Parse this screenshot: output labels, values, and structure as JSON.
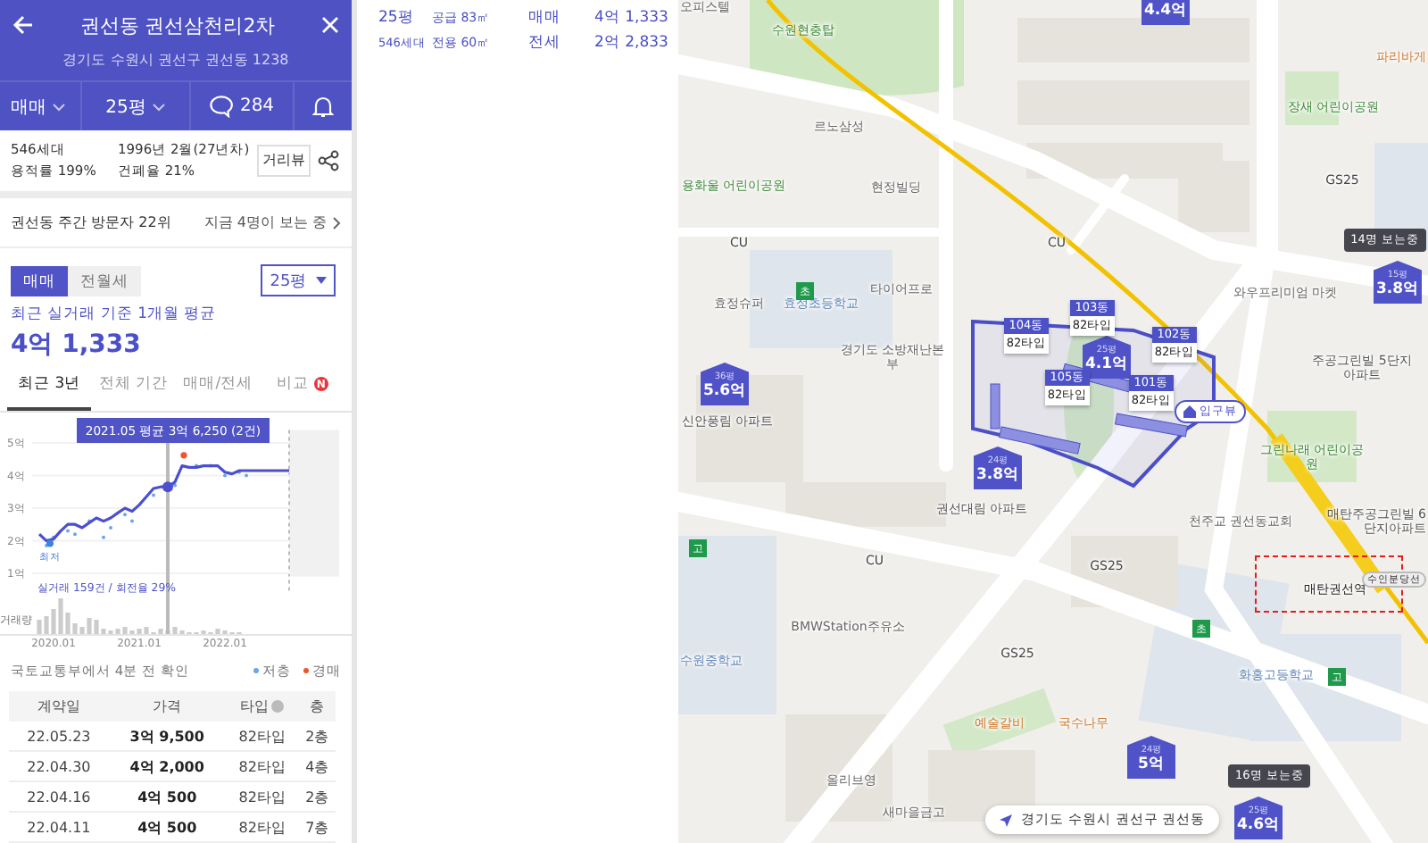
{
  "header": {
    "title": "권선동 권선삼천리2차",
    "address": "경기도 수원시 권선구 권선동 1238",
    "deal_type": "매매",
    "size": "25평",
    "comments": "284"
  },
  "info": {
    "households": "546세대",
    "floor_area_ratio": "용적률 199%",
    "built": "1996년 2월(27년차)",
    "coverage_ratio": "건폐율 21%",
    "street_view": "거리뷰"
  },
  "visitors": {
    "rank": "권선동 주간 방문자 22위",
    "viewing": "지금 4명이 보는 중"
  },
  "deal_toggle": [
    {
      "label": "매매",
      "selected": true
    },
    {
      "label": "전월세",
      "selected": false
    }
  ],
  "size_select": "25평",
  "average": {
    "caption": "최근 실거래 기준 1개월 평균",
    "price": "4억 1,333"
  },
  "period_tabs": [
    {
      "label": "최근 3년",
      "selected": true
    },
    {
      "label": "전체 기간",
      "selected": false
    },
    {
      "label": "매매/전세",
      "selected": false
    },
    {
      "label": "비교",
      "selected": false,
      "badge": "N"
    }
  ],
  "chart": {
    "tooltip": "2021.05 평균 3억 6,250 (2건)",
    "min_label": "최저",
    "stats": "실거래 159건 / 회전율 29%",
    "volume_label": "거래량",
    "chart_data": {
      "type": "line",
      "categories": [
        null,
        null,
        "2020.01",
        null,
        null,
        null,
        null,
        null,
        null,
        null,
        null,
        null,
        null,
        null,
        "2021.01",
        null,
        null,
        null,
        null,
        null,
        null,
        null,
        null,
        null,
        null,
        null,
        "2022.01",
        null,
        null,
        null,
        null,
        null,
        null,
        null,
        null,
        null
      ],
      "ylim": [
        0.9,
        5.4
      ],
      "grid": true,
      "series": [
        {
          "color": "#4b4fd0",
          "values": [
            2.2,
            2.0,
            2.05,
            2.3,
            2.5,
            2.5,
            2.4,
            2.55,
            2.7,
            2.6,
            2.7,
            2.85,
            3.0,
            2.9,
            3.1,
            3.35,
            3.6,
            3.65,
            3.65,
            3.8,
            4.3,
            4.25,
            4.25,
            4.3,
            4.3,
            4.3,
            4.1,
            4.05,
            4.15,
            4.15,
            4.15,
            4.15,
            4.15,
            4.15,
            4.15,
            4.15
          ]
        }
      ],
      "yticks": [
        {
          "value": 1,
          "label": "1억"
        },
        {
          "value": 2,
          "label": "2억"
        },
        {
          "value": 3,
          "label": "3억"
        },
        {
          "value": 4,
          "label": "4억"
        },
        {
          "value": 5,
          "label": "5억"
        }
      ]
    }
  },
  "source": "국토교통부에서 4분 전 확인",
  "legend": [
    {
      "label": "저층",
      "color": "#6aa6ea"
    },
    {
      "label": "경매",
      "color": "#f0532e"
    }
  ],
  "table": {
    "columns": [
      "계약일",
      "가격",
      "타입",
      "층"
    ],
    "rows": [
      [
        "22.05.23",
        "3억 9,500",
        "82타입",
        "2층"
      ],
      [
        "22.04.30",
        "4억 2,000",
        "82타입",
        "4층"
      ],
      [
        "22.04.16",
        "4억 500",
        "82타입",
        "2층"
      ],
      [
        "22.04.11",
        "4억 500",
        "82타입",
        "7층"
      ]
    ]
  },
  "summary": [
    {
      "size": "25평",
      "area": "공급 83㎡",
      "deal": "매매",
      "price": "4억 1,333"
    },
    {
      "size": "546세대",
      "area": "전용 60㎡",
      "deal": "전세",
      "price": "2억 2,833"
    }
  ],
  "map": {
    "places": [
      {
        "name": "오피스텔",
        "kind": "building"
      },
      {
        "name": "수원현충탑",
        "kind": "park"
      },
      {
        "name": "르노삼성",
        "kind": "building"
      },
      {
        "name": "용화울 어린이공원",
        "kind": "park"
      },
      {
        "name": "현정빌딩",
        "kind": "building"
      },
      {
        "name": "CU",
        "kind": "shop"
      },
      {
        "name": "CU",
        "kind": "shop"
      },
      {
        "name": "효정슈퍼",
        "kind": "building"
      },
      {
        "name": "효정초등학교",
        "kind": "school"
      },
      {
        "name": "타이어프로",
        "kind": "building"
      },
      {
        "name": "경기도 소방재난본부",
        "kind": "building"
      },
      {
        "name": "장새 어린이공원",
        "kind": "park"
      },
      {
        "name": "GS25",
        "kind": "shop"
      },
      {
        "name": "와우프리미엄 마켓",
        "kind": "building"
      },
      {
        "name": "주공그린빌 5단지아파트",
        "kind": "apartment"
      },
      {
        "name": "신안풍림 아파트",
        "kind": "apartment"
      },
      {
        "name": "권선대림 아파트",
        "kind": "apartment"
      },
      {
        "name": "CU",
        "kind": "shop"
      },
      {
        "name": "GS25",
        "kind": "shop"
      },
      {
        "name": "GS25",
        "kind": "shop"
      },
      {
        "name": "BMWStation주유소",
        "kind": "building"
      },
      {
        "name": "수원중학교",
        "kind": "school"
      },
      {
        "name": "예술갈비",
        "kind": "food"
      },
      {
        "name": "국수나무",
        "kind": "food"
      },
      {
        "name": "올리브영",
        "kind": "building"
      },
      {
        "name": "새마을금고",
        "kind": "building"
      },
      {
        "name": "천주교 권선동교회",
        "kind": "building"
      },
      {
        "name": "그린나래 어린이공원",
        "kind": "park"
      },
      {
        "name": "매탄주공그린빌 6단지아파트",
        "kind": "apartment"
      },
      {
        "name": "매탄권선역",
        "kind": "station"
      },
      {
        "name": "화홍고등학교",
        "kind": "school"
      },
      {
        "name": "파리바게",
        "kind": "food"
      }
    ],
    "school_flags": [
      {
        "label": "초"
      },
      {
        "label": "고"
      },
      {
        "label": "초"
      },
      {
        "label": "고"
      }
    ],
    "price_markers": [
      {
        "price": "4.4억"
      },
      {
        "size": "15평",
        "price": "3.8억"
      },
      {
        "size": "36평",
        "price": "5.6억"
      },
      {
        "size": "25평",
        "price": "4.1억"
      },
      {
        "size": "24평",
        "price": "3.8억"
      },
      {
        "size": "24평",
        "price": "5억"
      },
      {
        "size": "25평",
        "price": "4.6억"
      }
    ],
    "building_tags": [
      {
        "building": "104동",
        "type": "82타입"
      },
      {
        "building": "103동",
        "type": "82타입"
      },
      {
        "building": "102동",
        "type": "82타입"
      },
      {
        "building": "105동",
        "type": "82타입"
      },
      {
        "building": "101동",
        "type": "82타입"
      }
    ],
    "entrance": "입구뷰",
    "station_line": "수인분당선",
    "viewer_badges": [
      "14명 보는중",
      "16명 보는중"
    ],
    "location": "경기도 수원시 권선구 권선동"
  }
}
